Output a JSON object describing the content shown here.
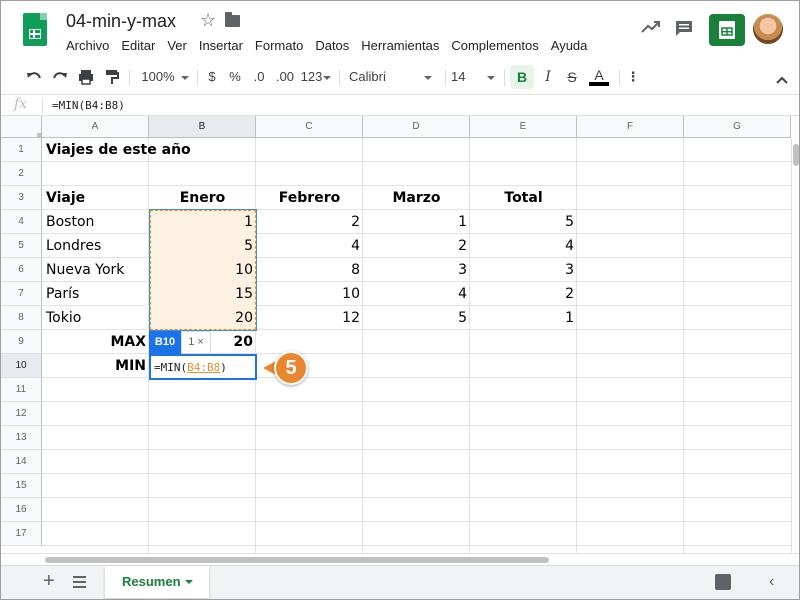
{
  "header": {
    "doc_title": "04-min-y-max",
    "menu": [
      "Archivo",
      "Editar",
      "Ver",
      "Insertar",
      "Formato",
      "Datos",
      "Herramientas",
      "Complementos",
      "Ayuda"
    ]
  },
  "toolbar": {
    "zoom": "100%",
    "currency": "$",
    "percent": "%",
    "decrease_decimals": ".0",
    "increase_decimals": ".00",
    "more_formats": "123",
    "font": "Calibri",
    "font_size": "14",
    "bold": "B",
    "italic": "I",
    "strikethrough": "S",
    "text_color": "A",
    "more": "⋮"
  },
  "formula_bar": {
    "fx": "fx",
    "formula": "=MIN(B4:B8)"
  },
  "columns": [
    "A",
    "B",
    "C",
    "D",
    "E",
    "F",
    "G"
  ],
  "rows": [
    "1",
    "2",
    "3",
    "4",
    "5",
    "6",
    "7",
    "8",
    "9",
    "10",
    "11",
    "12",
    "13",
    "14",
    "15",
    "16",
    "17"
  ],
  "sheet": {
    "A1": "Viajes de este año",
    "headers": [
      "Viaje",
      "Enero",
      "Febrero",
      "Marzo",
      "Total"
    ],
    "data": [
      [
        "Boston",
        "1",
        "2",
        "1",
        "5"
      ],
      [
        "Londres",
        "5",
        "4",
        "2",
        "4"
      ],
      [
        "Nueva York",
        "10",
        "8",
        "3",
        "3"
      ],
      [
        "París",
        "15",
        "10",
        "4",
        "2"
      ],
      [
        "Tokio",
        "20",
        "12",
        "5",
        "1"
      ]
    ],
    "max_label": "MAX",
    "max_value": "20",
    "min_label": "MIN"
  },
  "editor": {
    "cell_ref": "B10",
    "hint": "1 ×",
    "prefix": "=MIN(",
    "range": "B4:B8",
    "suffix": ")"
  },
  "callout": {
    "step": "5"
  },
  "bottom": {
    "add_sheet": "+",
    "sheet_tab": "Resumen",
    "collapse": "‹"
  },
  "colors": {
    "brand_green": "#188038",
    "selection_blue": "#1a73e8",
    "range_orange": "#e0922e",
    "callout_orange": "#e8872f"
  }
}
